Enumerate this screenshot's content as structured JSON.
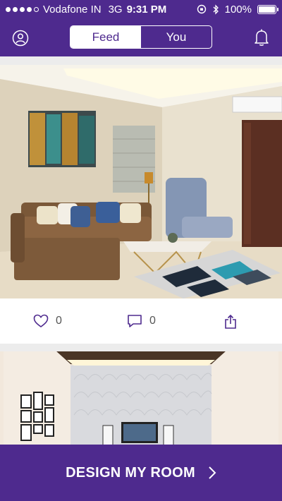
{
  "status": {
    "carrier": "Vodafone IN",
    "network": "3G",
    "time": "9:31 PM",
    "battery": "100%",
    "battery_level": 1.0,
    "signal_bars": 4
  },
  "header": {
    "tabs": [
      {
        "label": "Feed",
        "active": true
      },
      {
        "label": "You",
        "active": false
      }
    ]
  },
  "feed": {
    "posts": [
      {
        "likes": "0",
        "comments": "0"
      }
    ]
  },
  "cta": {
    "label": "DESIGN MY ROOM"
  },
  "colors": {
    "brand": "#4e2a8e",
    "icon": "#4e2a8e"
  }
}
